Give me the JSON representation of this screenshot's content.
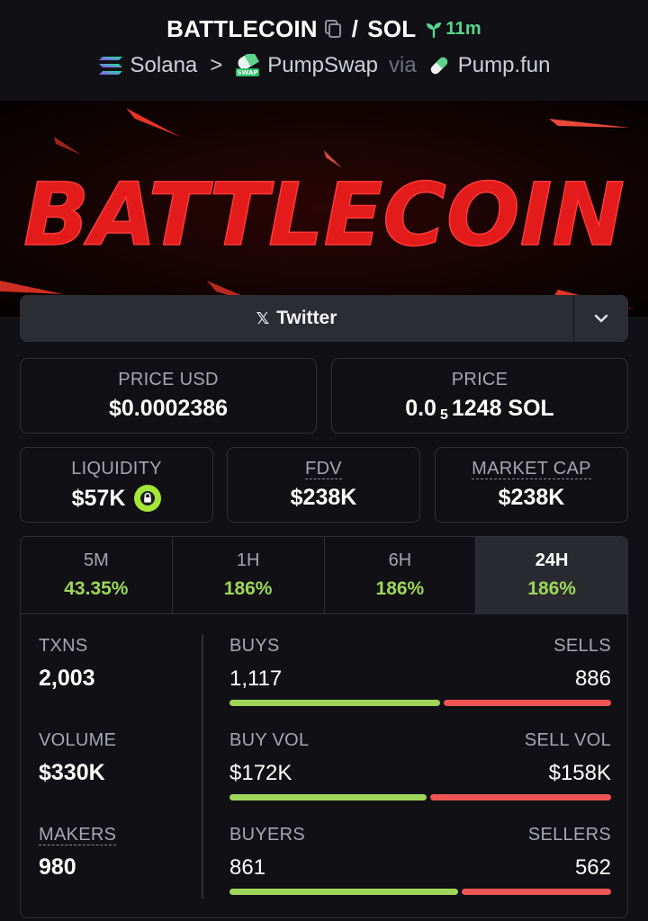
{
  "header": {
    "token_symbol": "BATTLECOIN",
    "slash": "/",
    "quote_symbol": "SOL",
    "age": "11m",
    "chain": "Solana",
    "dex": "PumpSwap",
    "via_label": "via",
    "launchpad": "Pump.fun",
    "separator": ">"
  },
  "banner": {
    "text": "BATTLECOIN"
  },
  "social": {
    "twitter_label": "Twitter"
  },
  "cards": {
    "price_usd": {
      "label": "PRICE USD",
      "value": "$0.0002386"
    },
    "price": {
      "label": "PRICE",
      "value_prefix": "0.0",
      "value_sub": "5",
      "value_suffix": "1248 SOL"
    },
    "liquidity": {
      "label": "LIQUIDITY",
      "value": "$57K"
    },
    "fdv": {
      "label": "FDV",
      "value": "$238K"
    },
    "market_cap": {
      "label": "MARKET CAP",
      "value": "$238K"
    }
  },
  "timeframes": [
    {
      "label": "5M",
      "change": "43.35%"
    },
    {
      "label": "1H",
      "change": "186%"
    },
    {
      "label": "6H",
      "change": "186%"
    },
    {
      "label": "24H",
      "change": "186%"
    }
  ],
  "stats": {
    "txns": {
      "label": "TXNS",
      "value": "2,003"
    },
    "volume": {
      "label": "VOLUME",
      "value": "$330K"
    },
    "makers": {
      "label": "MAKERS",
      "value": "980"
    },
    "buys": {
      "label": "BUYS",
      "value": "1,117",
      "buy_ratio": 0.558
    },
    "sells": {
      "label": "SELLS",
      "value": "886"
    },
    "buy_vol": {
      "label": "BUY VOL",
      "value": "$172K",
      "buy_ratio": 0.521
    },
    "sell_vol": {
      "label": "SELL VOL",
      "value": "$158K"
    },
    "buyers": {
      "label": "BUYERS",
      "value": "861",
      "buy_ratio": 0.605
    },
    "sellers": {
      "label": "SELLERS",
      "value": "562"
    }
  },
  "colors": {
    "accent_green": "#9fd65a",
    "sell_red": "#ef5555",
    "age_green": "#58d68d",
    "banner_red": "#e41b1b"
  }
}
